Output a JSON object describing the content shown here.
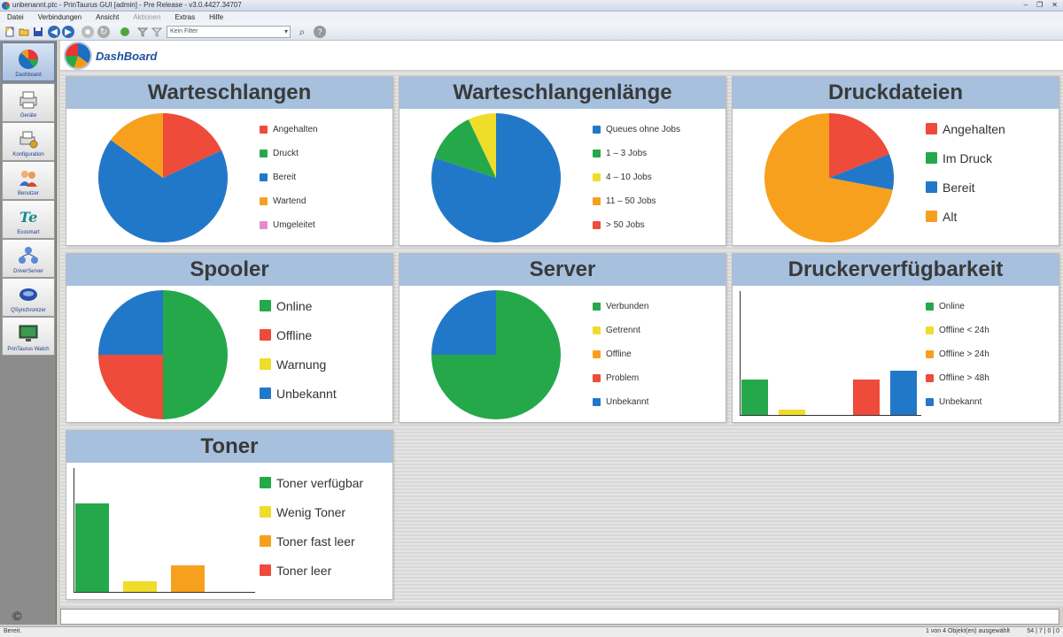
{
  "window": {
    "title": "unbenannt.ptc - PrinTaurus GUI [admin] - Pre Release - v3.0.4427.34707",
    "controls": [
      "–",
      "❐",
      "✕"
    ]
  },
  "menu": [
    "Datei",
    "Verbindungen",
    "Ansicht",
    "Aktionen",
    "Extras",
    "Hilfe"
  ],
  "toolbar": {
    "filter_placeholder": "Kein Filter"
  },
  "sidebar": [
    {
      "label": "Dashboard",
      "icon": "dashboard-pie-icon",
      "active": true
    },
    {
      "label": "Geräte",
      "icon": "printer-icon"
    },
    {
      "label": "Konfiguration",
      "icon": "printer-config-icon"
    },
    {
      "label": "Benutzer",
      "icon": "users-icon"
    },
    {
      "label": "Ecosmart",
      "icon": "ecosmart-icon"
    },
    {
      "label": "DriverServer",
      "icon": "driver-server-icon"
    },
    {
      "label": "QSynchronizer",
      "icon": "synchronizer-icon"
    },
    {
      "label": "PrinTaurus Watch",
      "icon": "monitor-icon"
    }
  ],
  "dashboard": {
    "title": "DashBoard"
  },
  "colors": {
    "red": "#ee4b3a",
    "green": "#25a84a",
    "blue": "#2278c8",
    "orange": "#f7a01e",
    "yellow": "#eedd2a",
    "pink": "#e58ad0",
    "header": "#a6c0de"
  },
  "panels": {
    "warteschlangen": {
      "title": "Warteschlangen",
      "legend": [
        {
          "label": "Angehalten",
          "color": "#ee4b3a"
        },
        {
          "label": "Druckt",
          "color": "#25a84a"
        },
        {
          "label": "Bereit",
          "color": "#2278c8"
        },
        {
          "label": "Wartend",
          "color": "#f7a01e"
        },
        {
          "label": "Umgeleitet",
          "color": "#e58ad0"
        }
      ]
    },
    "warteschlangenlaenge": {
      "title": "Warteschlangenlänge",
      "legend": [
        {
          "label": "Queues ohne Jobs",
          "color": "#2278c8"
        },
        {
          "label": "1 – 3 Jobs",
          "color": "#25a84a"
        },
        {
          "label": "4 – 10 Jobs",
          "color": "#eedd2a"
        },
        {
          "label": "11 – 50 Jobs",
          "color": "#f7a01e"
        },
        {
          "label": "> 50 Jobs",
          "color": "#ee4b3a"
        }
      ]
    },
    "druckdateien": {
      "title": "Druckdateien",
      "legend": [
        {
          "label": "Angehalten",
          "color": "#ee4b3a"
        },
        {
          "label": "Im Druck",
          "color": "#25a84a"
        },
        {
          "label": "Bereit",
          "color": "#2278c8"
        },
        {
          "label": "Alt",
          "color": "#f7a01e"
        }
      ]
    },
    "spooler": {
      "title": "Spooler",
      "legend": [
        {
          "label": "Online",
          "color": "#25a84a"
        },
        {
          "label": "Offline",
          "color": "#ee4b3a"
        },
        {
          "label": "Warnung",
          "color": "#eedd2a"
        },
        {
          "label": "Unbekannt",
          "color": "#2278c8"
        }
      ]
    },
    "server": {
      "title": "Server",
      "legend": [
        {
          "label": "Verbunden",
          "color": "#25a84a"
        },
        {
          "label": "Getrennt",
          "color": "#eedd2a"
        },
        {
          "label": "Offline",
          "color": "#f7a01e"
        },
        {
          "label": "Problem",
          "color": "#ee4b3a"
        },
        {
          "label": "Unbekannt",
          "color": "#2278c8"
        }
      ]
    },
    "druckerverfuegbarkeit": {
      "title": "Druckerverfügbarkeit",
      "legend": [
        {
          "label": "Online",
          "color": "#25a84a"
        },
        {
          "label": "Offline < 24h",
          "color": "#eedd2a"
        },
        {
          "label": "Offline > 24h",
          "color": "#f7a01e"
        },
        {
          "label": "Offline > 48h",
          "color": "#ee4b3a"
        },
        {
          "label": "Unbekannt",
          "color": "#2278c8"
        }
      ]
    },
    "toner": {
      "title": "Toner",
      "legend": [
        {
          "label": "Toner verfügbar",
          "color": "#25a84a"
        },
        {
          "label": "Wenig Toner",
          "color": "#eedd2a"
        },
        {
          "label": "Toner fast leer",
          "color": "#f7a01e"
        },
        {
          "label": "Toner leer",
          "color": "#ee4b3a"
        }
      ]
    }
  },
  "chart_data": [
    {
      "type": "pie",
      "title": "Warteschlangen",
      "series": [
        {
          "values": [
            {
              "label": "Angehalten",
              "value": 18
            },
            {
              "label": "Druckt",
              "value": 0
            },
            {
              "label": "Bereit",
              "value": 67
            },
            {
              "label": "Wartend",
              "value": 15
            },
            {
              "label": "Umgeleitet",
              "value": 0
            }
          ]
        }
      ]
    },
    {
      "type": "pie",
      "title": "Warteschlangenlänge",
      "series": [
        {
          "values": [
            {
              "label": "Queues ohne Jobs",
              "value": 80
            },
            {
              "label": "1 – 3 Jobs",
              "value": 13
            },
            {
              "label": "4 – 10 Jobs",
              "value": 7
            },
            {
              "label": "11 – 50 Jobs",
              "value": 0
            },
            {
              "label": "> 50 Jobs",
              "value": 0
            }
          ]
        }
      ]
    },
    {
      "type": "pie",
      "title": "Druckdateien",
      "series": [
        {
          "values": [
            {
              "label": "Angehalten",
              "value": 19
            },
            {
              "label": "Im Druck",
              "value": 0
            },
            {
              "label": "Bereit",
              "value": 9
            },
            {
              "label": "Alt",
              "value": 72
            }
          ]
        }
      ]
    },
    {
      "type": "pie",
      "title": "Spooler",
      "series": [
        {
          "values": [
            {
              "label": "Online",
              "value": 50
            },
            {
              "label": "Offline",
              "value": 25
            },
            {
              "label": "Warnung",
              "value": 0
            },
            {
              "label": "Unbekannt",
              "value": 25
            }
          ]
        }
      ]
    },
    {
      "type": "pie",
      "title": "Server",
      "series": [
        {
          "values": [
            {
              "label": "Verbunden",
              "value": 75
            },
            {
              "label": "Getrennt",
              "value": 0
            },
            {
              "label": "Offline",
              "value": 0
            },
            {
              "label": "Problem",
              "value": 0
            },
            {
              "label": "Unbekannt",
              "value": 25
            }
          ]
        }
      ]
    },
    {
      "type": "bar",
      "title": "Druckerverfügbarkeit",
      "categories": [
        "Online",
        "Offline < 24h",
        "Offline > 24h",
        "Offline > 48h",
        "Unbekannt"
      ],
      "values": [
        40,
        6,
        0,
        40,
        50
      ],
      "ylim": [
        0,
        140
      ]
    },
    {
      "type": "bar",
      "title": "Toner",
      "categories": [
        "Toner verfügbar",
        "Wenig Toner",
        "Toner fast leer",
        "Toner leer"
      ],
      "values": [
        100,
        12,
        30,
        0
      ],
      "ylim": [
        0,
        140
      ]
    }
  ],
  "statusbar": {
    "left": "Bereit.",
    "right": "1 von 4 Objekt(en) ausgewählt",
    "indicators": "54 | 7 | 0 | 0"
  },
  "copyright_symbol": "©"
}
